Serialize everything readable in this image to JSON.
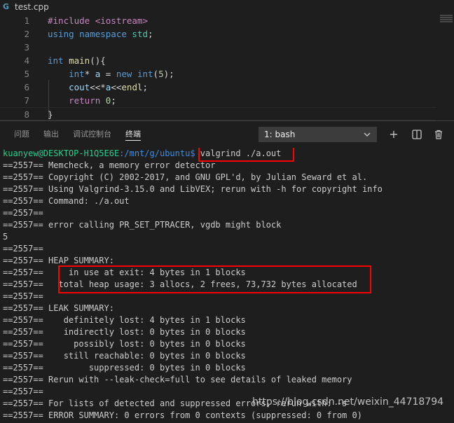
{
  "tab": {
    "file_name": "test.cpp",
    "file_icon_glyph": "G"
  },
  "editor": {
    "lines": [
      {
        "num": "1",
        "tokens": [
          {
            "t": "#include <iostream>",
            "c": "pp"
          }
        ]
      },
      {
        "num": "2",
        "tokens": [
          {
            "t": "using namespace",
            "c": "ns-kw"
          },
          {
            "t": " ",
            "c": "tx"
          },
          {
            "t": "std",
            "c": "tp"
          },
          {
            "t": ";",
            "c": "tx"
          }
        ]
      },
      {
        "num": "3",
        "tokens": []
      },
      {
        "num": "4",
        "tokens": [
          {
            "t": "int",
            "c": "ns-kw"
          },
          {
            "t": " ",
            "c": "tx"
          },
          {
            "t": "main",
            "c": "fn"
          },
          {
            "t": "(){",
            "c": "tx"
          }
        ]
      },
      {
        "num": "5",
        "tokens": [
          {
            "t": "    ",
            "c": "tx"
          },
          {
            "t": "int",
            "c": "ns-kw"
          },
          {
            "t": "* ",
            "c": "tx"
          },
          {
            "t": "a",
            "c": "vr"
          },
          {
            "t": " = ",
            "c": "tx"
          },
          {
            "t": "new",
            "c": "ns-kw"
          },
          {
            "t": " ",
            "c": "tx"
          },
          {
            "t": "int",
            "c": "ns-kw"
          },
          {
            "t": "(",
            "c": "tx"
          },
          {
            "t": "5",
            "c": "num"
          },
          {
            "t": ");",
            "c": "tx"
          }
        ]
      },
      {
        "num": "6",
        "tokens": [
          {
            "t": "    ",
            "c": "tx"
          },
          {
            "t": "cout",
            "c": "vr"
          },
          {
            "t": "<<*",
            "c": "tx"
          },
          {
            "t": "a",
            "c": "vr"
          },
          {
            "t": "<<",
            "c": "tx"
          },
          {
            "t": "endl",
            "c": "fn"
          },
          {
            "t": ";",
            "c": "tx"
          }
        ]
      },
      {
        "num": "7",
        "tokens": [
          {
            "t": "    ",
            "c": "tx"
          },
          {
            "t": "return",
            "c": "ctl"
          },
          {
            "t": " ",
            "c": "tx"
          },
          {
            "t": "0",
            "c": "num"
          },
          {
            "t": ";",
            "c": "tx"
          }
        ]
      },
      {
        "num": "8",
        "tokens": [
          {
            "t": "}",
            "c": "tx"
          }
        ]
      }
    ]
  },
  "panel": {
    "tabs": [
      "问题",
      "输出",
      "调试控制台",
      "终端"
    ],
    "active_tab": "终端",
    "terminal_select": "1: bash",
    "icons": {
      "add": "+",
      "split": "split-icon",
      "trash": "trash-icon"
    }
  },
  "terminal": {
    "prompt_user": "kuanyew@DESKTOP-H1Q5E6E",
    "prompt_path": ":/mnt/g/ubuntu$",
    "command": " valgrind ./a.out",
    "lines": [
      "==2557== Memcheck, a memory error detector",
      "==2557== Copyright (C) 2002-2017, and GNU GPL'd, by Julian Seward et al.",
      "==2557== Using Valgrind-3.15.0 and LibVEX; rerun with -h for copyright info",
      "==2557== Command: ./a.out",
      "==2557==",
      "==2557== error calling PR_SET_PTRACER, vgdb might block",
      "5",
      "==2557==",
      "==2557== HEAP SUMMARY:",
      "==2557==     in use at exit: 4 bytes in 1 blocks",
      "==2557==   total heap usage: 3 allocs, 2 frees, 73,732 bytes allocated",
      "==2557==",
      "==2557== LEAK SUMMARY:",
      "==2557==    definitely lost: 4 bytes in 1 blocks",
      "==2557==    indirectly lost: 0 bytes in 0 blocks",
      "==2557==      possibly lost: 0 bytes in 0 blocks",
      "==2557==    still reachable: 0 bytes in 0 blocks",
      "==2557==         suppressed: 0 bytes in 0 blocks",
      "==2557== Rerun with --leak-check=full to see details of leaked memory",
      "==2557==",
      "==2557== For lists of detected and suppressed errors, rerun with: -s",
      "==2557== ERROR SUMMARY: 0 errors from 0 contexts (suppressed: 0 from 0)"
    ]
  },
  "watermark": "https://blog.csdn.net/weixin_44718794",
  "colors": {
    "highlight_box": "#ff0000",
    "prompt_user": "#23d18b",
    "prompt_path": "#3b8eea"
  }
}
